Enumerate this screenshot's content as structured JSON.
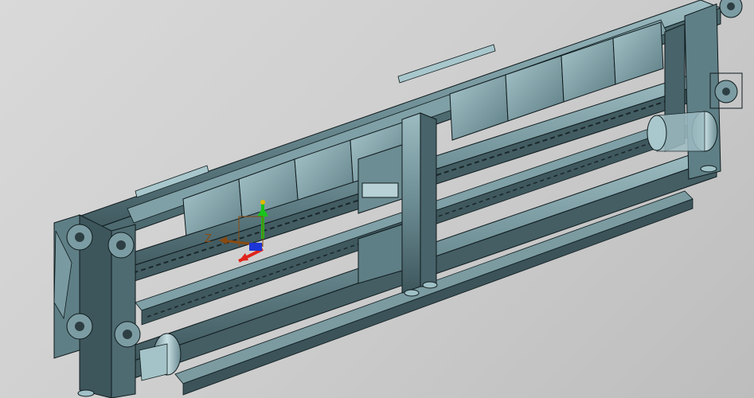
{
  "viewport": {
    "background_top": "#d9d9d9",
    "background_bottom": "#bdbdbd"
  },
  "model": {
    "body_color": "#5f7f86",
    "body_light": "#8fb0b6",
    "body_dark": "#2f464c",
    "edge_color": "#0f1a1c",
    "roller_color": "#9fc0c7"
  },
  "triad": {
    "z_label": "Z",
    "x_color": "#e0241b",
    "y_color": "#19c41b",
    "z_color": "#8a4a10",
    "pivot_color": "#1c36d6"
  }
}
